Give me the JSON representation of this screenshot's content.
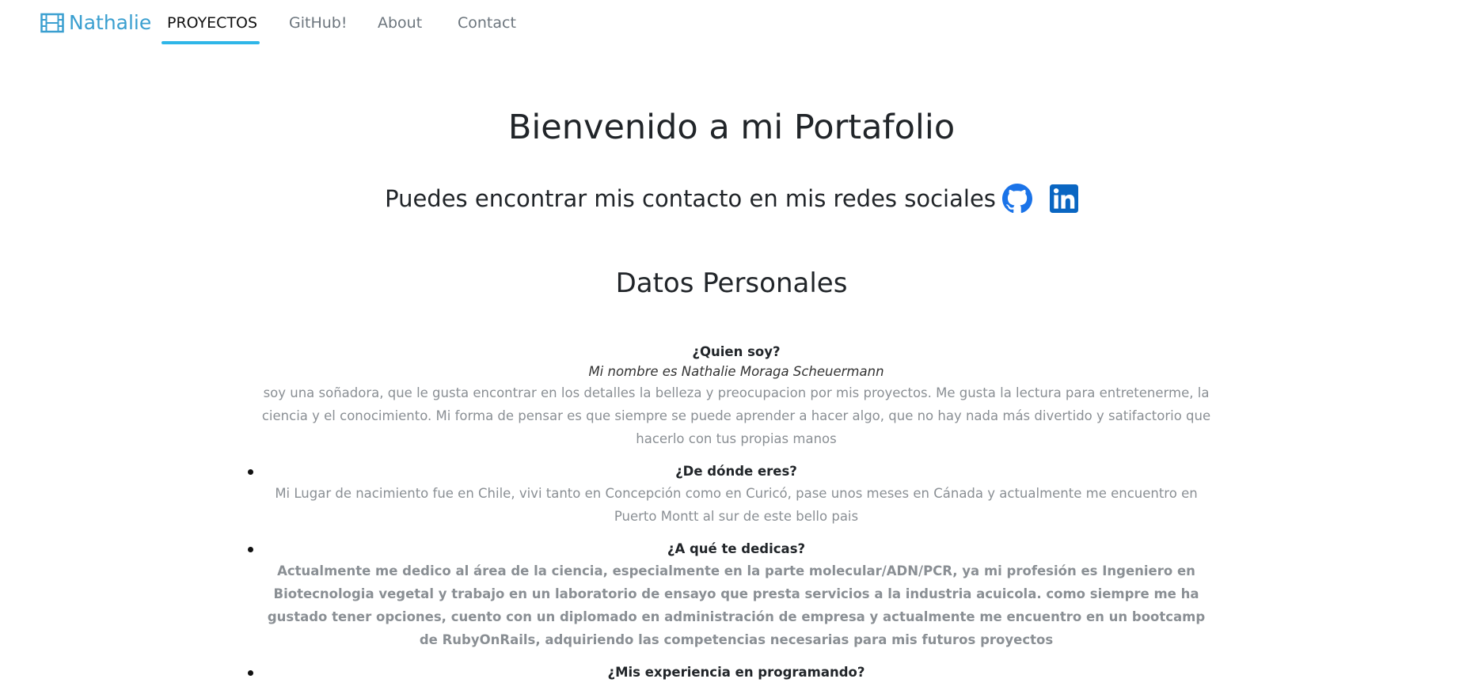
{
  "nav": {
    "brand": "Nathalie",
    "items": [
      "PROYECTOS",
      "GitHub!",
      "About",
      "Contact"
    ]
  },
  "main": {
    "title": "Bienvenido a mi Portafolio",
    "social_text": "Puedes encontrar mis contacto en mis redes sociales",
    "section_title": "Datos Personales"
  },
  "about": {
    "q1": "¿Quien soy?",
    "name": "Mi nombre es Nathalie Moraga Scheuermann",
    "a1": "soy una soñadora, que le gusta encontrar en los detalles la belleza y preocupacion por mis proyectos. Me gusta la lectura para entretenerme, la ciencia y el conocimiento. Mi forma de pensar es que siempre se puede aprender a hacer algo, que no hay nada más divertido y satifactorio que hacerlo con tus propias manos",
    "q2": "¿De dónde eres?",
    "a2": "Mi Lugar de nacimiento fue en Chile, vivi tanto en Concepción como en Curicó, pase unos meses en Cánada y actualmente me encuentro en Puerto Montt al sur de este bello pais",
    "q3": "¿A qué te dedicas?",
    "a3": "Actualmente me dedico al área de la ciencia, especialmente en la parte molecular/ADN/PCR, ya mi profesión es Ingeniero en Biotecnologia vegetal y trabajo en un laboratorio de ensayo que presta servicios a la industria acuicola. como siempre me ha gustado tener opciones, cuento con un diplomado en administración de empresa y actualmente me encuentro en un bootcamp de RubyOnRails, adquiriendo las competencias necesarias para mis futuros proyectos",
    "q4": "¿Mis experiencia en programando?"
  },
  "colors": {
    "brand": "#3a9fd0",
    "underline": "#2eb6e8",
    "github_icon": "#1a73e8",
    "linkedin_icon": "#0a66c2"
  },
  "icons": [
    "film-icon",
    "github-icon",
    "linkedin-icon"
  ]
}
